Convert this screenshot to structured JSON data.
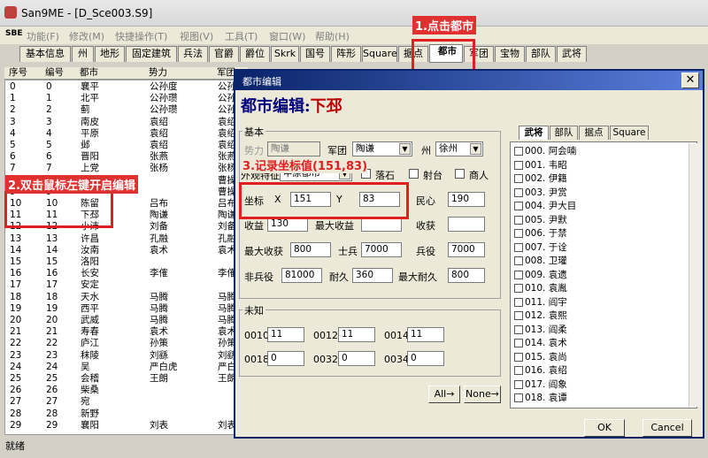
{
  "window": {
    "title": "San9ME - [D_Sce003.S9]"
  },
  "menu": {
    "logo": "SBE",
    "items": [
      "功能(F)",
      "修改(M)",
      "快捷操作(T)",
      "视图(V)",
      "工具(T)",
      "窗口(W)",
      "帮助(H)"
    ]
  },
  "tabs": [
    "基本信息",
    "州",
    "地形",
    "固定建筑",
    "兵法",
    "官爵",
    "爵位",
    "Skrk",
    "国号",
    "阵形",
    "Square",
    "据点",
    "都市",
    "军团",
    "宝物",
    "部队",
    "武将"
  ],
  "list": {
    "headers": [
      "序号",
      "编号",
      "都市",
      "势力",
      "军团"
    ],
    "rows": [
      [
        "0",
        "0",
        "襄平",
        "公孙度",
        "公孙"
      ],
      [
        "1",
        "1",
        "北平",
        "公孙瓒",
        "公孙"
      ],
      [
        "2",
        "2",
        "蓟",
        "公孙瓒",
        "公孙"
      ],
      [
        "3",
        "3",
        "南皮",
        "袁绍",
        "袁绍"
      ],
      [
        "4",
        "4",
        "平原",
        "袁绍",
        "袁绍"
      ],
      [
        "5",
        "5",
        "邺",
        "袁绍",
        "袁绍"
      ],
      [
        "6",
        "6",
        "晋阳",
        "张燕",
        "张燕"
      ],
      [
        "7",
        "7",
        "上党",
        "张杨",
        "张杨"
      ],
      [
        "8",
        "8",
        "",
        "",
        "曹操"
      ],
      [
        "9",
        "9",
        "",
        "",
        "曹操"
      ],
      [
        "10",
        "10",
        "陈留",
        "吕布",
        "吕布"
      ],
      [
        "11",
        "11",
        "下邳",
        "陶谦",
        "陶谦"
      ],
      [
        "12",
        "12",
        "小沛",
        "刘备",
        "刘备"
      ],
      [
        "13",
        "13",
        "许昌",
        "孔融",
        "孔融"
      ],
      [
        "14",
        "14",
        "汝南",
        "袁术",
        "袁术"
      ],
      [
        "15",
        "15",
        "洛阳",
        "",
        ""
      ],
      [
        "16",
        "16",
        "长安",
        "李傕",
        "李傕"
      ],
      [
        "17",
        "17",
        "安定",
        "",
        ""
      ],
      [
        "18",
        "18",
        "天水",
        "马腾",
        "马腾"
      ],
      [
        "19",
        "19",
        "西平",
        "马腾",
        "马腾"
      ],
      [
        "20",
        "20",
        "武威",
        "马腾",
        "马腾"
      ],
      [
        "21",
        "21",
        "寿春",
        "袁术",
        "袁术"
      ],
      [
        "22",
        "22",
        "庐江",
        "孙策",
        "孙策"
      ],
      [
        "23",
        "23",
        "秣陵",
        "刘繇",
        "刘繇"
      ],
      [
        "24",
        "24",
        "吴",
        "严白虎",
        "严白"
      ],
      [
        "25",
        "25",
        "会稽",
        "王朗",
        "王朗"
      ],
      [
        "26",
        "26",
        "柴桑",
        "",
        ""
      ],
      [
        "27",
        "27",
        "宛",
        "",
        ""
      ],
      [
        "28",
        "28",
        "新野",
        "",
        ""
      ],
      [
        "29",
        "29",
        "襄阳",
        "刘表",
        "刘表"
      ]
    ]
  },
  "status": "就绪",
  "annotations": {
    "a1": "1.点击都市",
    "a2": "2.双击鼠标左键开启编辑",
    "a3": "3.记录坐标值(151,83)"
  },
  "dialog": {
    "title": "都市编辑",
    "heading": "都市编辑:",
    "city": "下邳",
    "basic": {
      "group": "基本",
      "power_label": "势力",
      "power_value": "陶谦",
      "corps_label": "军团",
      "corps_value": "陶谦",
      "state_label": "州",
      "state_value": "徐州",
      "appearance_label": "外观特征",
      "appearance_value": "中原都市",
      "falling_stone": "落石",
      "archery": "射台",
      "merchant": "商人",
      "coord_label": "坐标",
      "x_label": "X",
      "x_value": "151",
      "y_label": "Y",
      "y_value": "83",
      "morale_label": "民心",
      "morale_value": "190",
      "income_label": "收益",
      "income_value": "130",
      "max_income_label": "最大收益",
      "max_income_value": "",
      "harvest_label": "收获",
      "harvest_value": "",
      "max_harvest_label": "最大收获",
      "max_harvest_value": "800",
      "soldiers_label": "士兵",
      "soldiers_value": "7000",
      "troops_label": "兵役",
      "troops_value": "7000",
      "nonservice_label": "非兵役",
      "nonservice_value": "81000",
      "durability_label": "耐久",
      "durability_value": "360",
      "max_durability_label": "最大耐久",
      "max_durability_value": "800"
    },
    "unknown": {
      "group": "未知",
      "fields": [
        {
          "label": "0010",
          "value": "11"
        },
        {
          "label": "0012",
          "value": "11"
        },
        {
          "label": "0014",
          "value": "11"
        },
        {
          "label": "0018",
          "value": "0"
        },
        {
          "label": "0032",
          "value": "0"
        },
        {
          "label": "0034",
          "value": "0"
        }
      ]
    },
    "right_tabs": [
      "武将",
      "部队",
      "据点",
      "Square"
    ],
    "officers": [
      "000. 阿会喃",
      "001. 韦昭",
      "002. 伊籍",
      "003. 尹赏",
      "004. 尹大目",
      "005. 尹默",
      "006. 于禁",
      "007. 于诠",
      "008. 卫瓘",
      "009. 袁遗",
      "010. 袁胤",
      "011. 阎宇",
      "012. 袁熙",
      "013. 阎柔",
      "014. 袁术",
      "015. 袁尚",
      "016. 袁绍",
      "017. 阎象",
      "018. 袁谭"
    ],
    "all_btn": "All→",
    "none_btn": "None→",
    "ok": "OK",
    "cancel": "Cancel"
  }
}
